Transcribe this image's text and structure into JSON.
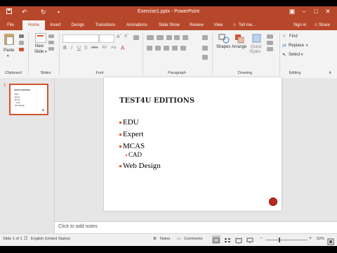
{
  "titlebar": {
    "title": "Exercise1.pptx - PowerPoint",
    "restore_icon": "restore-icon",
    "minimize_icon": "minimize-icon",
    "maximize_icon": "maximize-icon",
    "close_icon": "close-icon"
  },
  "tabs": {
    "file": "File",
    "home": "Home",
    "insert": "Insert",
    "design": "Design",
    "transitions": "Transitions",
    "animations": "Animations",
    "slideshow": "Slide Show",
    "review": "Review",
    "view": "View",
    "tellme": "Tell me...",
    "signin": "Sign in",
    "share": "Share"
  },
  "ribbon": {
    "paste": "Paste",
    "new_slide_line1": "New",
    "new_slide_line2": "Slide",
    "shapes": "Shapes",
    "arrange": "Arrange",
    "quick_styles_line1": "Quick",
    "quick_styles_line2": "Styles",
    "find": "Find",
    "replace": "Replace",
    "select": "Select",
    "groups": {
      "clipboard": "Clipboard",
      "slides": "Slides",
      "font": "Font",
      "paragraph": "Paragraph",
      "drawing": "Drawing",
      "editing": "Editing"
    }
  },
  "thumbnails": {
    "number": "1",
    "title": "TEST4U EDITIONS",
    "items": [
      "EDU",
      "Expert",
      "MCAS",
      "CAD",
      "Web Design"
    ]
  },
  "slide": {
    "title": "TEST4U EDITIONS",
    "bullets": [
      "EDU",
      "Expert",
      "MCAS"
    ],
    "sub_bullet": "CAD",
    "last_bullet": "Web Design"
  },
  "notes": {
    "placeholder": "Click to add notes"
  },
  "status": {
    "slide_info": "Slide 1 of 1",
    "language": "English (United States)",
    "notes": "Notes",
    "comments": "Comments",
    "zoom": "52%"
  }
}
